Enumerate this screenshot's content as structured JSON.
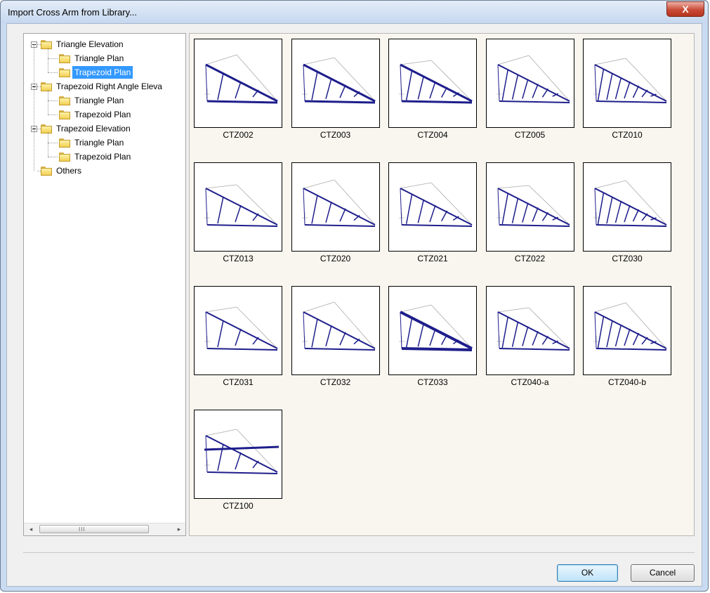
{
  "window": {
    "title": "Import Cross Arm from Library...",
    "close_glyph": "X"
  },
  "tree": {
    "groups": [
      {
        "label": "Triangle Elevation",
        "expander": "minus",
        "children": [
          {
            "label": "Triangle Plan",
            "selected": false
          },
          {
            "label": "Trapezoid Plan",
            "selected": true
          }
        ]
      },
      {
        "label": "Trapezoid Right Angle Eleva",
        "expander": "minus",
        "children": [
          {
            "label": "Triangle Plan",
            "selected": false
          },
          {
            "label": "Trapezoid Plan",
            "selected": false
          }
        ]
      },
      {
        "label": "Trapezoid Elevation",
        "expander": "minus",
        "children": [
          {
            "label": "Triangle Plan",
            "selected": false
          },
          {
            "label": "Trapezoid Plan",
            "selected": false
          }
        ]
      },
      {
        "label": "Others",
        "expander": "none",
        "children": []
      }
    ],
    "icons": {
      "folder": "folder-icon",
      "expander": "minus-box-icon"
    }
  },
  "scrollbar": {
    "left_arrow": "◂",
    "right_arrow": "▸",
    "grip": "III"
  },
  "gallery": {
    "items": [
      {
        "caption": "CTZ002"
      },
      {
        "caption": "CTZ003"
      },
      {
        "caption": "CTZ004"
      },
      {
        "caption": "CTZ005"
      },
      {
        "caption": "CTZ010"
      },
      {
        "caption": "CTZ013"
      },
      {
        "caption": "CTZ020"
      },
      {
        "caption": "CTZ021"
      },
      {
        "caption": "CTZ022"
      },
      {
        "caption": "CTZ030"
      },
      {
        "caption": "CTZ031"
      },
      {
        "caption": "CTZ032"
      },
      {
        "caption": "CTZ033"
      },
      {
        "caption": "CTZ040-a"
      },
      {
        "caption": "CTZ040-b"
      },
      {
        "caption": "CTZ100"
      }
    ]
  },
  "buttons": {
    "ok": "OK",
    "cancel": "Cancel"
  },
  "colors": {
    "selection": "#3399ff",
    "truss": "#1e1e8c",
    "title_bar": "#c6d8ef",
    "gallery_bg": "#f8f6ef"
  }
}
